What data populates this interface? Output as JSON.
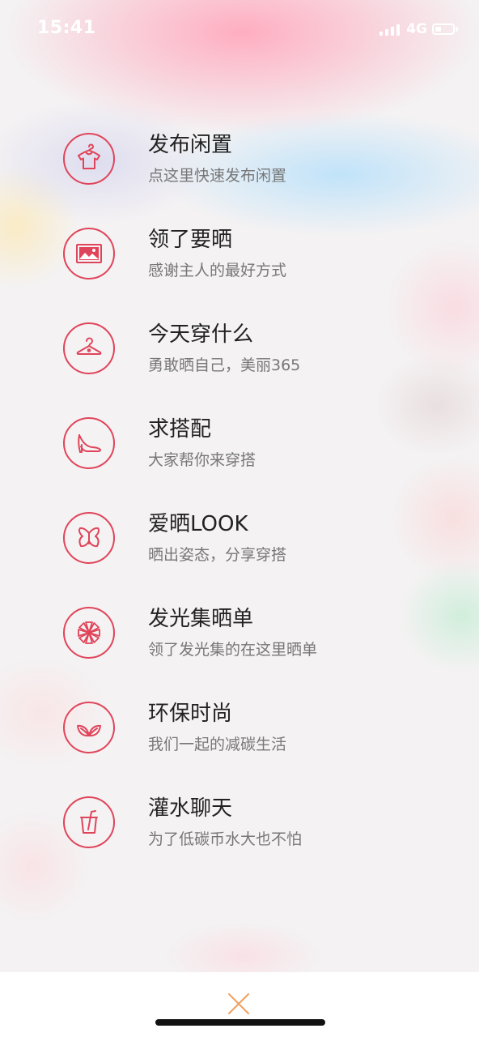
{
  "status_bar": {
    "time": "15:41",
    "network": "4G",
    "battery_level": 0.35
  },
  "menu": {
    "accent_color": "#e0445a",
    "items": [
      {
        "title": "发布闲置",
        "subtitle": "点这里快速发布闲置",
        "icon": "tshirt-icon"
      },
      {
        "title": "领了要晒",
        "subtitle": "感谢主人的最好方式",
        "icon": "picture-icon"
      },
      {
        "title": "今天穿什么",
        "subtitle": "勇敢晒自己，美丽365",
        "icon": "hanger-icon"
      },
      {
        "title": "求搭配",
        "subtitle": "大家帮你来穿搭",
        "icon": "high-heel-icon"
      },
      {
        "title": "爱晒LOOK",
        "subtitle": "晒出姿态，分享穿搭",
        "icon": "butterfly-icon"
      },
      {
        "title": "发光集晒单",
        "subtitle": "领了发光集的在这里晒单",
        "icon": "flower-icon"
      },
      {
        "title": "环保时尚",
        "subtitle": "我们一起的减碳生活",
        "icon": "leaf-icon"
      },
      {
        "title": "灌水聊天",
        "subtitle": "为了低碳币水大也不怕",
        "icon": "drink-cup-icon"
      }
    ]
  },
  "bottom_bar": {
    "close_icon": "close-icon",
    "close_color": "#f0a060"
  }
}
